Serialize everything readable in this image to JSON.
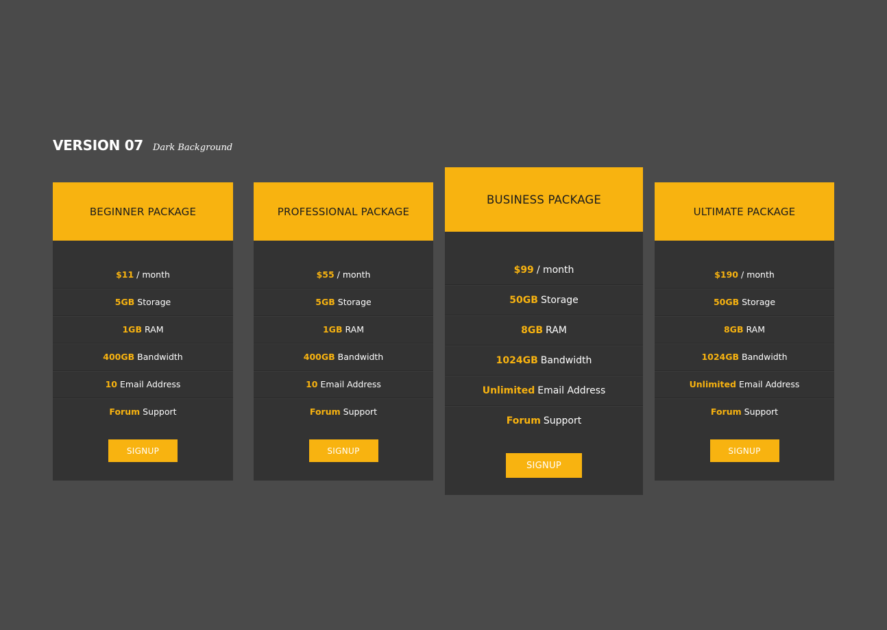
{
  "heading": {
    "title": "VERSION 07",
    "subtitle": "Dark Background"
  },
  "colors": {
    "background": "#4a4a4a",
    "card": "#333333",
    "accent": "#f8b310"
  },
  "plans": [
    {
      "name": "BEGINNER PACKAGE",
      "price": "$11",
      "price_suffix": "/ month",
      "storage": "5GB",
      "storage_label": "Storage",
      "ram": "1GB",
      "ram_label": "RAM",
      "bandwidth": "400GB",
      "bandwidth_label": "Bandwidth",
      "email": "10",
      "email_label": "Email Address",
      "support": "Forum",
      "support_label": "Support",
      "button": "SIGNUP"
    },
    {
      "name": "PROFESSIONAL PACKAGE",
      "price": "$55",
      "price_suffix": "/ month",
      "storage": "5GB",
      "storage_label": "Storage",
      "ram": "1GB",
      "ram_label": "RAM",
      "bandwidth": "400GB",
      "bandwidth_label": "Bandwidth",
      "email": "10",
      "email_label": "Email Address",
      "support": "Forum",
      "support_label": "Support",
      "button": "SIGNUP"
    },
    {
      "name": "BUSINESS PACKAGE",
      "price": "$99",
      "price_suffix": "/ month",
      "storage": "50GB",
      "storage_label": "Storage",
      "ram": "8GB",
      "ram_label": "RAM",
      "bandwidth": "1024GB",
      "bandwidth_label": "Bandwidth",
      "email": "Unlimited",
      "email_label": "Email Address",
      "support": "Forum",
      "support_label": "Support",
      "button": "SIGNUP"
    },
    {
      "name": "ULTIMATE PACKAGE",
      "price": "$190",
      "price_suffix": "/ month",
      "storage": "50GB",
      "storage_label": "Storage",
      "ram": "8GB",
      "ram_label": "RAM",
      "bandwidth": "1024GB",
      "bandwidth_label": "Bandwidth",
      "email": "Unlimited",
      "email_label": "Email Address",
      "support": "Forum",
      "support_label": "Support",
      "button": "SIGNUP"
    }
  ]
}
